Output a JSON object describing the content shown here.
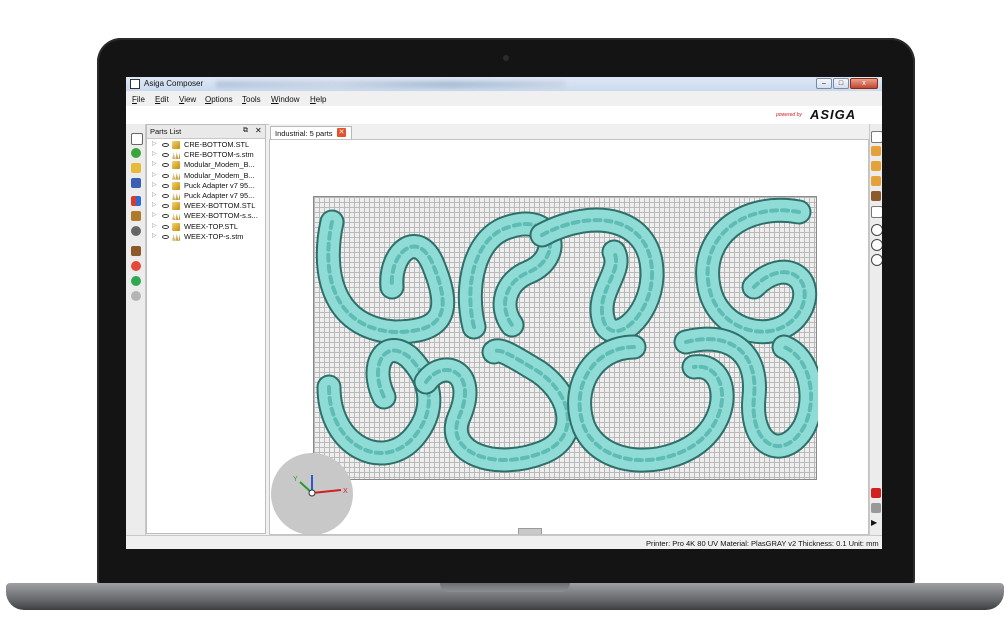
{
  "window": {
    "title": "Asiga Composer",
    "controls": {
      "minimize": "–",
      "maximize": "□",
      "close": "x"
    }
  },
  "menu": [
    "File",
    "Edit",
    "View",
    "Options",
    "Tools",
    "Window",
    "Help"
  ],
  "brand": {
    "powered_by": "powered by",
    "name": "ASIGA"
  },
  "parts_panel": {
    "title": "Parts List",
    "float_icon": "restore-icon",
    "close_glyph": "✕",
    "items": [
      {
        "name": "CRE-BOTTOM.STL",
        "icon": "solid-part-icon"
      },
      {
        "name": "CRE-BOTTOM-s.stm",
        "icon": "support-part-icon"
      },
      {
        "name": "Modular_Modem_B...",
        "icon": "solid-part-icon"
      },
      {
        "name": "Modular_Modem_B...",
        "icon": "support-part-icon"
      },
      {
        "name": "Puck Adapter v7 95...",
        "icon": "solid-part-icon"
      },
      {
        "name": "Puck Adapter v7 95...",
        "icon": "support-part-icon"
      },
      {
        "name": "WEEX-BOTTOM.STL",
        "icon": "solid-part-icon"
      },
      {
        "name": "WEEX-BOTTOM-s.s...",
        "icon": "support-part-icon"
      },
      {
        "name": "WEEX-TOP.STL",
        "icon": "solid-part-icon"
      },
      {
        "name": "WEEX-TOP-s.stm",
        "icon": "support-part-icon"
      }
    ]
  },
  "tab": {
    "label": "Industrial: 5 parts",
    "close_glyph": "✕"
  },
  "gizmo": {
    "x_label": "X",
    "y_label": "Y"
  },
  "status": "Printer: Pro 4K 80 UV  Material: PlasGRAY v2  Thickness: 0.1  Unit: mm",
  "colors": {
    "part_fill": "#8fdcd6",
    "part_outline": "#4ba59f",
    "support_dash": "#8a3b8a",
    "accent_red": "#d02020"
  }
}
